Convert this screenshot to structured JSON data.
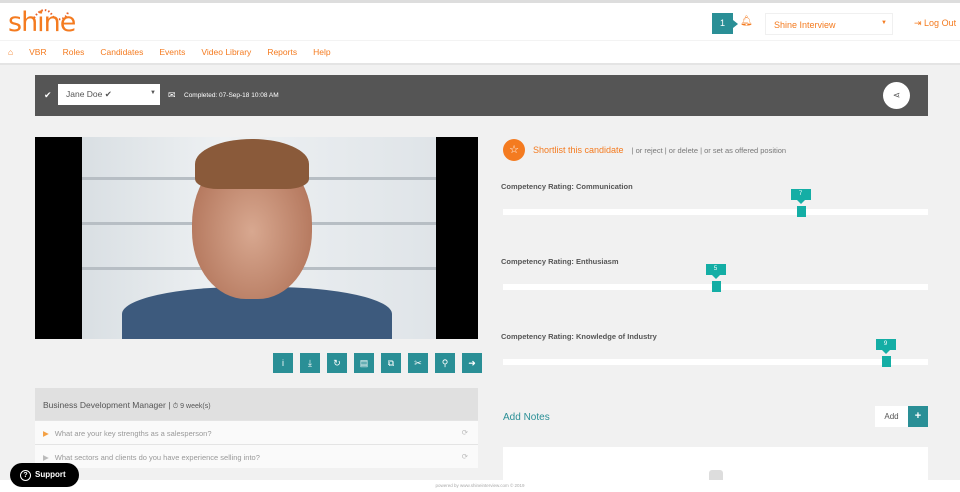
{
  "header": {
    "logo": "shine",
    "notification_count": "1",
    "company_select": "Shine Interview",
    "logout": "Log Out"
  },
  "nav": {
    "items": [
      "VBR",
      "Roles",
      "Candidates",
      "Events",
      "Video Library",
      "Reports",
      "Help"
    ]
  },
  "candidate_bar": {
    "candidate": "Jane Doe ✔",
    "completed": "Completed: 07-Sep-18 10:08 AM"
  },
  "toolbar": {
    "icons": [
      "info-icon",
      "download-icon",
      "refresh-icon",
      "document-icon",
      "copy-icon",
      "scissors-icon",
      "search-icon",
      "arrow-right-icon"
    ],
    "glyphs": [
      "i",
      "⤓",
      "↻",
      "▤",
      "⧉",
      "✂",
      "⚲",
      "➜"
    ]
  },
  "questions": {
    "role": "Business Development Manager | ",
    "duration": "⏱ 9 week(s)",
    "items": [
      "What are your key strengths as a salesperson?",
      "What sectors and clients do you have experience selling into?"
    ]
  },
  "shortlist": {
    "label": "Shortlist this candidate",
    "options": "| or reject | or delete | or set as offered position"
  },
  "ratings": {
    "min": 0,
    "max": 10,
    "items": [
      {
        "label": "Competency Rating: Communication",
        "value": 7
      },
      {
        "label": "Competency Rating: Enthusiasm",
        "value": 5
      },
      {
        "label": "Competency Rating: Knowledge of Industry",
        "value": 9
      }
    ]
  },
  "notes": {
    "title": "Add Notes",
    "add": "Add"
  },
  "footer": "powered by www.shineinterview.com © 2019",
  "support": "Support",
  "colors": {
    "accent": "#f47b20",
    "teal": "#2a8f96",
    "slider": "#14aea5"
  }
}
